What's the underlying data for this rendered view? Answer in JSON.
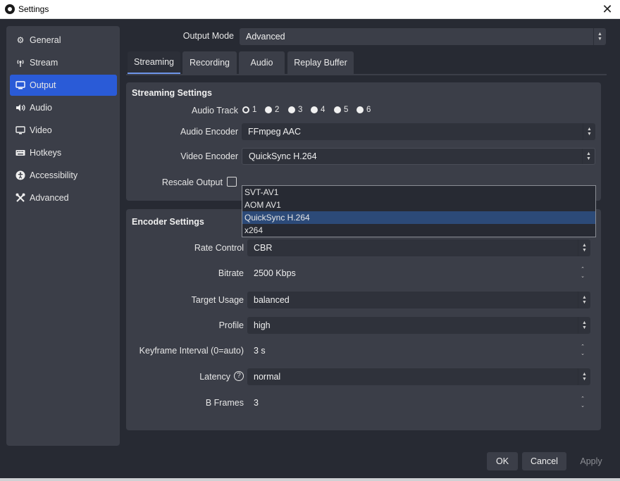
{
  "window": {
    "title": "Settings"
  },
  "sidebar": {
    "items": [
      {
        "label": "General",
        "icon": "gear-icon"
      },
      {
        "label": "Stream",
        "icon": "broadcast-icon"
      },
      {
        "label": "Output",
        "icon": "monitor-output-icon",
        "active": true
      },
      {
        "label": "Audio",
        "icon": "speaker-icon"
      },
      {
        "label": "Video",
        "icon": "display-icon"
      },
      {
        "label": "Hotkeys",
        "icon": "keyboard-icon"
      },
      {
        "label": "Accessibility",
        "icon": "accessibility-icon"
      },
      {
        "label": "Advanced",
        "icon": "tools-icon"
      }
    ]
  },
  "output_mode": {
    "label": "Output Mode",
    "value": "Advanced"
  },
  "tabs": [
    "Streaming",
    "Recording",
    "Audio",
    "Replay Buffer"
  ],
  "active_tab": "Streaming",
  "streaming_settings": {
    "title": "Streaming Settings",
    "audio_track": {
      "label": "Audio Track",
      "options": [
        "1",
        "2",
        "3",
        "4",
        "5",
        "6"
      ],
      "selected": "1"
    },
    "audio_encoder": {
      "label": "Audio Encoder",
      "value": "FFmpeg AAC"
    },
    "video_encoder": {
      "label": "Video Encoder",
      "value": "QuickSync H.264"
    },
    "rescale_output": {
      "label": "Rescale Output",
      "checked": false
    },
    "encoder_dropdown": {
      "options": [
        "SVT-AV1",
        "AOM AV1",
        "QuickSync H.264",
        "x264"
      ],
      "highlighted": "QuickSync H.264"
    }
  },
  "encoder_settings": {
    "title": "Encoder Settings",
    "rate_control": {
      "label": "Rate Control",
      "value": "CBR"
    },
    "bitrate": {
      "label": "Bitrate",
      "value": "2500 Kbps"
    },
    "target_usage": {
      "label": "Target Usage",
      "value": "balanced"
    },
    "profile": {
      "label": "Profile",
      "value": "high"
    },
    "keyframe_interval": {
      "label": "Keyframe Interval (0=auto)",
      "value": "3 s"
    },
    "latency": {
      "label": "Latency",
      "value": "normal"
    },
    "b_frames": {
      "label": "B Frames",
      "value": "3"
    }
  },
  "buttons": {
    "ok": "OK",
    "cancel": "Cancel",
    "apply": "Apply"
  },
  "colors": {
    "accent": "#2a5bd7",
    "window_bg": "#272a33",
    "panel_bg": "#3b3e48",
    "selection": "#2c4a78"
  }
}
